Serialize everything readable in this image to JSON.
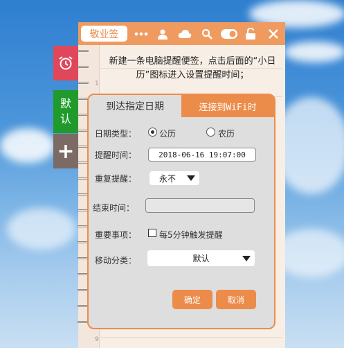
{
  "titlebar": {
    "category_label": "敬业签",
    "icons": [
      "more-icon",
      "user-icon",
      "cloud-icon",
      "search-icon",
      "toggle-icon",
      "unlock-icon",
      "close-icon"
    ]
  },
  "side_tabs": {
    "alarm_icon": "alarm-clock-icon",
    "default_line1": "默",
    "default_line2": "认",
    "add_label": "+"
  },
  "note": {
    "line_number_first": "1",
    "line_number_last": "9",
    "text": "新建一条电脑提醒便签，点击后面的“小日历”图标进入设置提醒时间；"
  },
  "dialog": {
    "tabs": [
      "到达指定日期",
      "连接到WiFi时"
    ],
    "date_type": {
      "label": "日期类型：",
      "option_solar": "公历",
      "option_lunar": "农历"
    },
    "remind_time": {
      "label": "提醒时间：",
      "value": "2018-06-16 19:07:00"
    },
    "repeat": {
      "label": "重复提醒：",
      "value": "永不"
    },
    "end_time": {
      "label": "结束时间：",
      "value": ""
    },
    "important": {
      "label": "重要事项：",
      "checkbox_text": "每5分钟触发提醒"
    },
    "move_category": {
      "label": "移动分类：",
      "value": "默认"
    },
    "confirm_label": "确定",
    "cancel_label": "取消"
  },
  "colors": {
    "accent": "#ec8c4b",
    "alarm_tab": "#e0475a",
    "default_tab": "#1f9a2b",
    "add_tab": "#7c6a64"
  }
}
